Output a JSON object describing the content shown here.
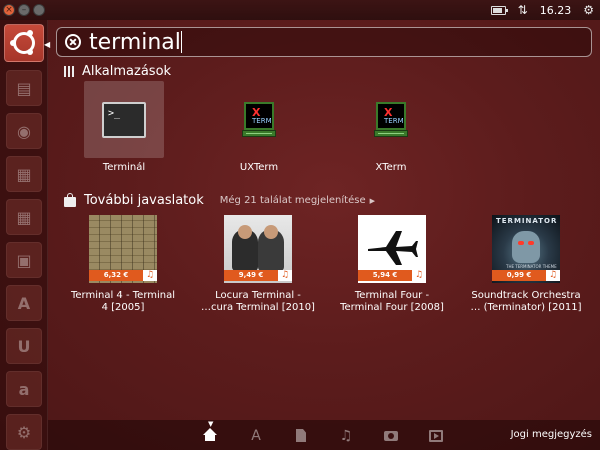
{
  "panel": {
    "clock": "16.23",
    "icons": [
      "battery-icon",
      "network-icon",
      "settings-icon"
    ]
  },
  "search": {
    "query": "terminal"
  },
  "applications": {
    "header": "Alkalmazások",
    "items": [
      {
        "label": "Terminál",
        "icon": "terminal-icon",
        "selected": true
      },
      {
        "label": "UXTerm",
        "icon": "xterm-icon",
        "selected": false
      },
      {
        "label": "XTerm",
        "icon": "xterm-icon",
        "selected": false
      }
    ],
    "xterm_icon_text": {
      "x": "X",
      "term": "TERM"
    },
    "terminal_glyph": ">_"
  },
  "suggestions": {
    "header": "További javaslatok",
    "more_link": "Még 21 találat megjelenítése",
    "items": [
      {
        "line1": "Terminal 4 - Terminal",
        "line2": "4 [2005]",
        "price": "6,32 €"
      },
      {
        "line1": "Locura Terminal -",
        "line2": "…cura Terminal [2010]",
        "price": "9,49 €"
      },
      {
        "line1": "Terminal Four -",
        "line2": "Terminal Four [2008]",
        "price": "5,94 €"
      },
      {
        "line1": "Soundtrack Orchestra",
        "line2": "… (Terminator) [2011]",
        "price": "0,99 €"
      }
    ],
    "cover4_title": "TERMINATOR",
    "cover4_sub": "THE TERMINATOR THEME"
  },
  "lens_bar": {
    "legal": "Jogi megjegyzés",
    "lenses": [
      "home-icon",
      "applications-icon",
      "files-icon",
      "music-icon",
      "photos-icon",
      "video-icon"
    ]
  },
  "colors": {
    "accent": "#e05a1e",
    "dash_background": "#5a1a1a",
    "launcher_button": "#b8402f"
  }
}
